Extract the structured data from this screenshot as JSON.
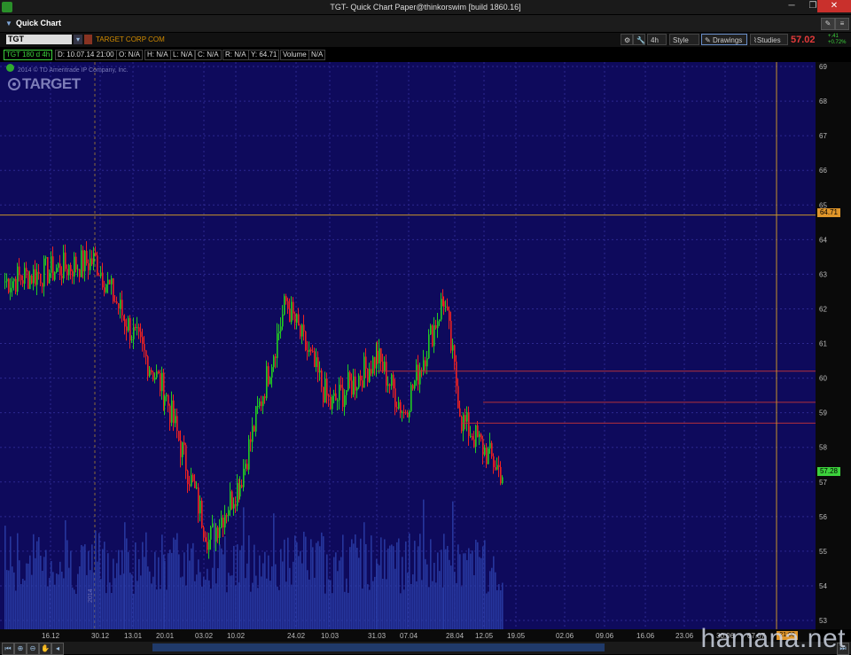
{
  "window": {
    "title": "TGT- Quick Chart Paper@thinkorswim [build 1860.16]",
    "app_icon": "thinkorswim-icon"
  },
  "panel": {
    "title": "Quick Chart"
  },
  "symbol": {
    "value": "TGT",
    "company": "TARGET CORP COM"
  },
  "toolbar": {
    "aggregation": "4h",
    "style": "Style",
    "drawings": "Drawings",
    "studies": "Studies",
    "last_price": "57.02",
    "change_abs": "+.41",
    "change_pct": "+0.72%"
  },
  "info": {
    "symbol_spec": "TGT 180 d 4h",
    "date": "D: 10.07.14 21:00",
    "open": "O: N/A",
    "high": "H: N/A",
    "low": "L: N/A",
    "close": "C: N/A",
    "range": "R: N/A",
    "y": "Y: 64.71",
    "volume_label": "Volume",
    "volume": "N/A"
  },
  "chart": {
    "copyright": "2014 © TD Ameritrade IP Company, Inc.",
    "logo": "TARGET",
    "price_axis": [
      "69",
      "68",
      "67",
      "66",
      "65",
      "64",
      "63",
      "62",
      "61",
      "60",
      "59",
      "58",
      "57",
      "56",
      "55",
      "54",
      "53"
    ],
    "price_tags": {
      "cursor": "64.71",
      "last": "57.28"
    },
    "date_axis": [
      "16.12",
      "30.12",
      "13.01",
      "20.01",
      "03.02",
      "10.02",
      "24.02",
      "10.03",
      "31.03",
      "07.04",
      "28.04",
      "12.05",
      "19.05",
      "02.06",
      "09.06",
      "16.06",
      "23.06",
      "30.06",
      "07.07"
    ],
    "time_tag": "21:00",
    "year_marker": "2014",
    "colors": {
      "background": "#0e0a5c",
      "up": "#22cc22",
      "down": "#ee2222",
      "volume": "#2a3ea8",
      "hline": "#b5303a",
      "cursor": "#c8942a"
    }
  },
  "watermark": "hamana.net",
  "chart_data": {
    "type": "candlestick",
    "ylim": [
      53,
      69
    ],
    "x": [
      "16.12",
      "30.12",
      "13.01",
      "20.01",
      "03.02",
      "10.02",
      "24.02",
      "10.03",
      "31.03",
      "07.04",
      "28.04",
      "12.05",
      "19.05"
    ],
    "close": [
      62.8,
      63.4,
      61.7,
      59.6,
      55.3,
      57.0,
      62.2,
      59.2,
      60.6,
      59.0,
      62.3,
      58.8,
      57.2
    ],
    "horizontal_lines": [
      64.71,
      60.2,
      59.3,
      58.7
    ],
    "crosshair": {
      "x": "10.07.14 21:00",
      "y": 64.71
    }
  }
}
